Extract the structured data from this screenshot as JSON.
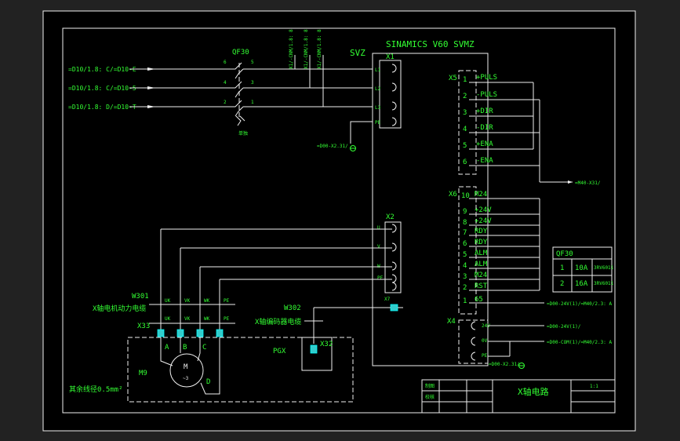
{
  "title_block": {
    "drawing_title": "X轴电路",
    "scale": "1:1",
    "row1_label": "制图",
    "row2_label": "校核"
  },
  "drive": {
    "model": "SINAMICS V60  SVMZ",
    "model_left": "SVZ"
  },
  "inputs": [
    {
      "label": "=D10/1.8: C/=D10-E"
    },
    {
      "label": "=D10/1.8: C/=D10-5"
    },
    {
      "label": "=D10/1.8: D/=D10-T"
    }
  ],
  "breaker": {
    "tag": "QF30",
    "left_pins": [
      "6",
      "4",
      "2"
    ],
    "right_pins": [
      "5",
      "3",
      "1"
    ],
    "note": "单独"
  },
  "vertical_refs": [
    "X1/-CNM/1.8: 8",
    "X1/-CNM/1.8: 8",
    "X1/-CNM/1.8: 8"
  ],
  "x1": {
    "tag": "X1",
    "pins": [
      "L1",
      "L2",
      "L3",
      "PE"
    ]
  },
  "x1_ground_ref": "=D00-X2.31/",
  "x5": {
    "tag": "X5",
    "pins": [
      {
        "num": "1",
        "name": "+PULS"
      },
      {
        "num": "2",
        "name": "-PULS"
      },
      {
        "num": "3",
        "name": "+DIR"
      },
      {
        "num": "4",
        "name": "-DIR"
      },
      {
        "num": "5",
        "name": "+ENA"
      },
      {
        "num": "6",
        "name": "-ENA"
      }
    ],
    "bus_ref": "=M40-X31/"
  },
  "x6": {
    "tag": "X6",
    "pins": [
      {
        "num": "10",
        "name": "M24"
      },
      {
        "num": "9",
        "name": "+24V"
      },
      {
        "num": "8",
        "name": "+24V"
      },
      {
        "num": "7",
        "name": "RDY"
      },
      {
        "num": "6",
        "name": "RDY"
      },
      {
        "num": "5",
        "name": "ALM"
      },
      {
        "num": "4",
        "name": "ALM"
      },
      {
        "num": "3",
        "name": "M24"
      },
      {
        "num": "2",
        "name": "RST"
      },
      {
        "num": "1",
        "name": "65"
      }
    ],
    "pin1_ref": "=D00-24V(1)/=M40/2.3: A"
  },
  "x4": {
    "tag": "X4",
    "pins": [
      "24V",
      "0V",
      "PE"
    ],
    "refs": [
      "=D00-24V(1)/",
      "=D00-COM(1)/=M40/2.3: A",
      "=D00-X2.31/"
    ]
  },
  "x2": {
    "tag": "X2",
    "pins": [
      "U",
      "V",
      "W",
      "PE"
    ]
  },
  "x7": {
    "tag": "X7"
  },
  "w301": {
    "tag": "W301",
    "caption": "X轴电机动力电缆",
    "cores": [
      "UK",
      "VK",
      "WK",
      "PE"
    ]
  },
  "x33": {
    "tag": "X33",
    "cores": [
      "UK",
      "VK",
      "WK",
      "PE"
    ]
  },
  "w302": {
    "tag": "W302",
    "caption": "X轴编码器电缆"
  },
  "motor": {
    "tag": "M9",
    "symbol": "M",
    "sub": "~3",
    "terminals": [
      "A",
      "B",
      "C",
      "D"
    ]
  },
  "encoder": {
    "tag": "PGX",
    "connector": "X32"
  },
  "note": "其余线径0.5mm²",
  "qf_table": {
    "title": "QF30",
    "rows": [
      {
        "no": "1",
        "rating": "10A",
        "code": "3RV6011"
      },
      {
        "no": "2",
        "rating": "16A",
        "code": "3RV6011"
      }
    ]
  }
}
